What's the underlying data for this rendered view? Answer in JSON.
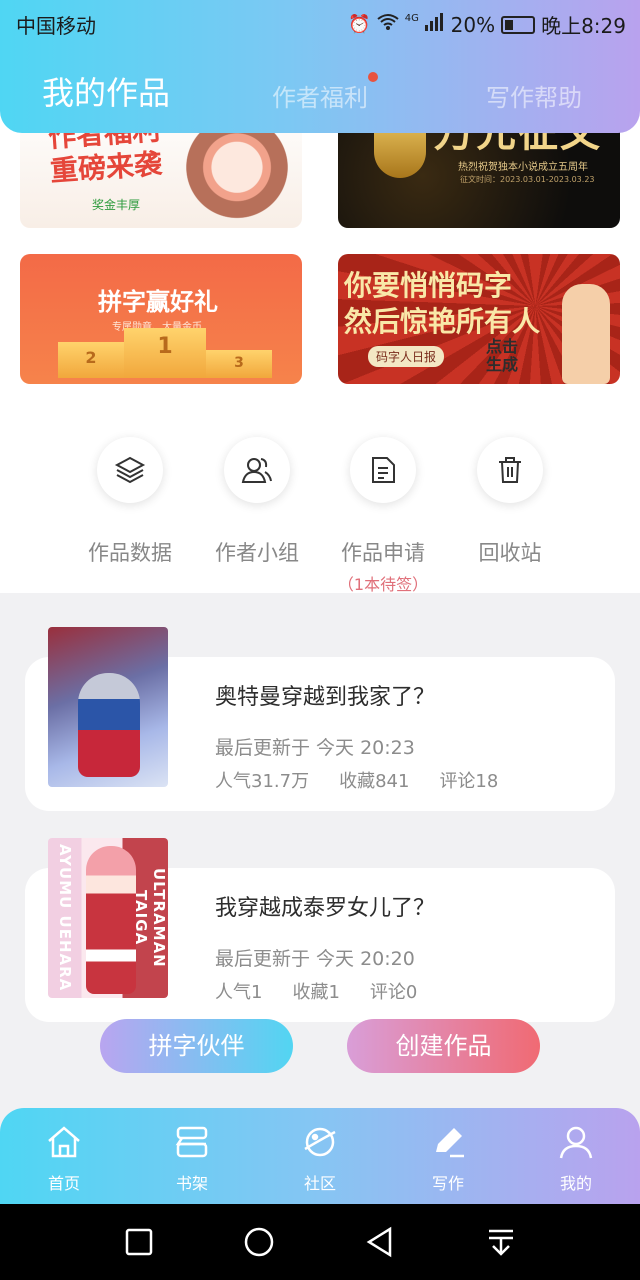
{
  "status": {
    "carrier": "中国移动",
    "signal_label": "4G",
    "battery": "20%",
    "time": "晚上8:29"
  },
  "tabs": [
    {
      "label": "我的作品",
      "active": true
    },
    {
      "label": "作者福利",
      "has_dot": true
    },
    {
      "label": "写作帮助"
    }
  ],
  "banners": {
    "b1": {
      "line1": "作者福利",
      "line2": "重磅来袭",
      "tag": "奖金丰厚"
    },
    "b2": {
      "title": "万元征文",
      "small": "热烈祝贺独本小说成立五周年",
      "small2": "征文时间：2023.03.01-2023.03.23"
    },
    "b3": {
      "title": "拼字赢好礼",
      "sub": "专属勋章、大量金币",
      "p1": "1",
      "p2": "2",
      "p3": "3"
    },
    "b4": {
      "line1": "你要悄悄码字",
      "line2": "然后惊艳所有人",
      "badge": "码字人日报",
      "click": "点击生成"
    }
  },
  "actions": [
    {
      "label": "作品数据",
      "icon": "layers-icon"
    },
    {
      "label": "作者小组",
      "icon": "group-icon"
    },
    {
      "label": "作品申请",
      "sub": "（1本待签）",
      "icon": "document-icon"
    },
    {
      "label": "回收站",
      "icon": "trash-icon"
    }
  ],
  "works": [
    {
      "title": "奥特曼穿越到我家了？",
      "updated": "最后更新于 今天 20:23",
      "popularity": "人气31.7万",
      "favorites": "收藏841",
      "comments": "评论18"
    },
    {
      "title": "我穿越成泰罗女儿了？",
      "updated": "最后更新于 今天 20:20",
      "popularity": "人气1",
      "favorites": "收藏1",
      "comments": "评论0",
      "cover_left": "AYUMU UEHARA",
      "cover_right": "ULTRAMAN TAIGA"
    }
  ],
  "buttons": {
    "partner": "拼字伙伴",
    "create": "创建作品"
  },
  "bottom_nav": [
    {
      "label": "首页",
      "icon": "home-icon"
    },
    {
      "label": "书架",
      "icon": "bookshelf-icon"
    },
    {
      "label": "社区",
      "icon": "planet-icon"
    },
    {
      "label": "写作",
      "icon": "pen-icon",
      "active": true
    },
    {
      "label": "我的",
      "icon": "user-icon"
    }
  ],
  "colors": {
    "accent_cyan": "#4fd6f3",
    "accent_purple": "#b9a2ee",
    "pending": "#e0707a"
  }
}
